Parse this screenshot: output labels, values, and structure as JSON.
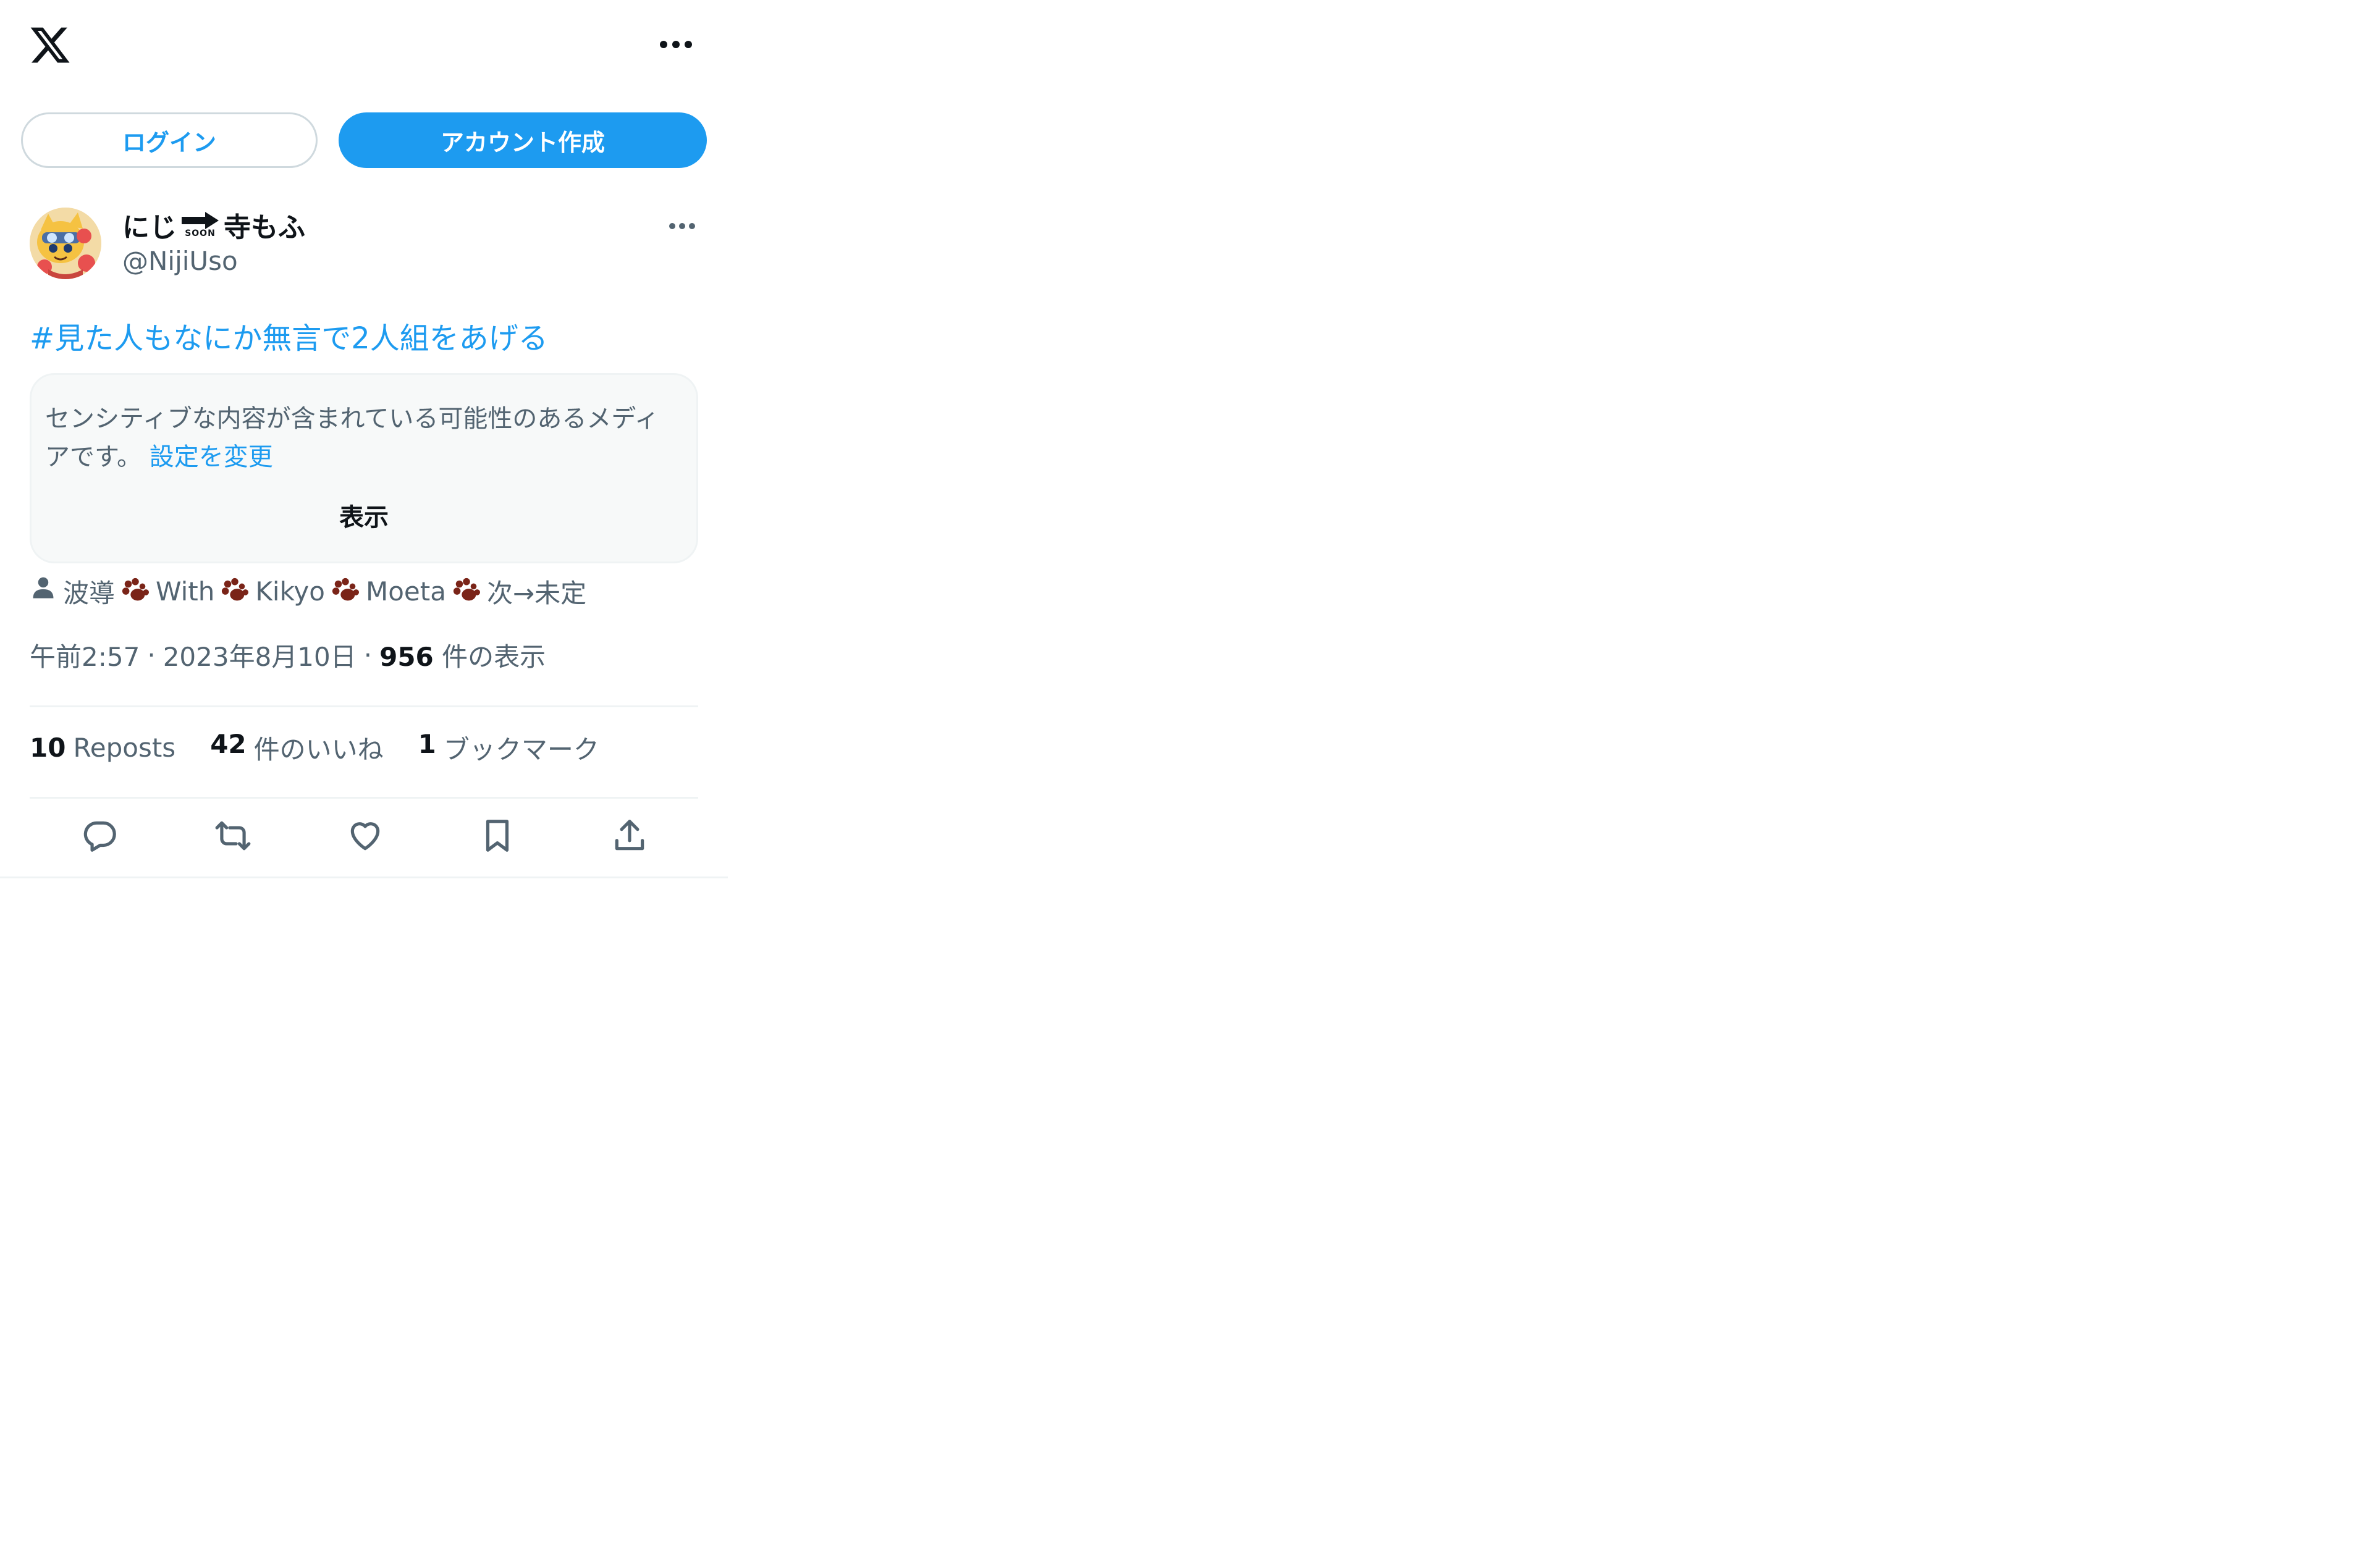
{
  "header": {
    "logo_icon": "x-logo-icon",
    "more_icon": "more-horizontal-icon"
  },
  "auth": {
    "login_label": "ログイン",
    "signup_label": "アカウント作成"
  },
  "tweet": {
    "author": {
      "name_part1": "にじ",
      "name_soon": "SOON",
      "name_part2": "寺もふ",
      "handle": "@NijiUso"
    },
    "hashtag": "#見た人もなにか無言で2人組をあげる",
    "sensitive": {
      "message": "センシティブな内容が含まれている可能性のあるメディアです。",
      "settings_link": "設定を変更",
      "show_label": "表示"
    },
    "location": {
      "part1": "波導",
      "part2": "With",
      "part3": "Kikyo",
      "part4": "Moeta",
      "part5": "次→未定"
    },
    "meta": {
      "time": "午前2:57",
      "date": "2023年8月10日",
      "separator": "·",
      "views_count": "956",
      "views_label": "件の表示"
    },
    "stats": {
      "reposts_count": "10",
      "reposts_label": "Reposts",
      "likes_count": "42",
      "likes_label": "件のいいね",
      "bookmarks_count": "1",
      "bookmarks_label": "ブックマーク"
    },
    "actions": [
      "reply-icon",
      "repost-icon",
      "like-icon",
      "bookmark-icon",
      "share-icon"
    ]
  },
  "colors": {
    "accent": "#1d9bf0",
    "text_primary": "#0f1419",
    "text_secondary": "#536471",
    "border": "#eff3f4"
  }
}
